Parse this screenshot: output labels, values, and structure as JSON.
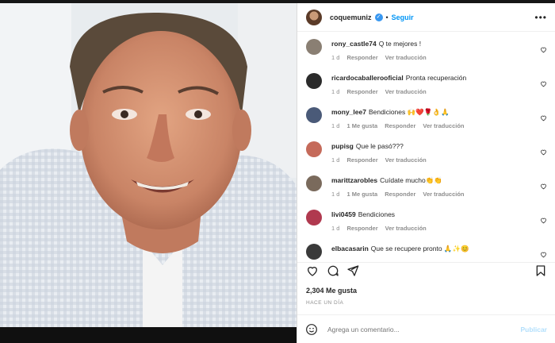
{
  "header": {
    "username": "coquemuniz",
    "verified_mark": "✓",
    "follow_label": "Seguir",
    "more_icon": "ellipsis-icon"
  },
  "comments": [
    {
      "user": "rony_castle74",
      "text": "Q te mejores !",
      "time": "1 d",
      "likes": "",
      "reply": "Responder",
      "translate": "Ver traducción",
      "avatar_color": "#8a7f73"
    },
    {
      "user": "ricardocaballerooficial",
      "text": "Pronta recuperación",
      "time": "1 d",
      "likes": "",
      "reply": "Responder",
      "translate": "Ver traducción",
      "avatar_color": "#2b2b2b"
    },
    {
      "user": "mony_lee7",
      "text": "Bendiciones 🙌❤️🌹👌🙏",
      "time": "1 d",
      "likes": "1 Me gusta",
      "reply": "Responder",
      "translate": "Ver traducción",
      "avatar_color": "#4a5a78"
    },
    {
      "user": "pupisg",
      "text": "Que le pasó???",
      "time": "1 d",
      "likes": "",
      "reply": "Responder",
      "translate": "Ver traducción",
      "avatar_color": "#c56a5a"
    },
    {
      "user": "marittzarobles",
      "text": "Cuídate mucho👏👏",
      "time": "1 d",
      "likes": "1 Me gusta",
      "reply": "Responder",
      "translate": "Ver traducción",
      "avatar_color": "#7a6a5c"
    },
    {
      "user": "livi0459",
      "text": "Bendiciones",
      "time": "1 d",
      "likes": "",
      "reply": "Responder",
      "translate": "Ver traducción",
      "avatar_color": "#b0394f"
    },
    {
      "user": "elbacasarin",
      "text": "Que se recupere pronto 🙏✨😊",
      "time": "",
      "likes": "",
      "reply": "",
      "translate": "",
      "avatar_color": "#3a3a3a"
    }
  ],
  "post": {
    "likes": "2,304 Me gusta",
    "time_ago": "HACE UN DÍA"
  },
  "comment_box": {
    "placeholder": "Agrega un comentario...",
    "publish_label": "Publicar"
  },
  "colors": {
    "accent": "#0095f6",
    "publish_disabled": "#b2dffc",
    "muted": "#8e8e8e"
  }
}
